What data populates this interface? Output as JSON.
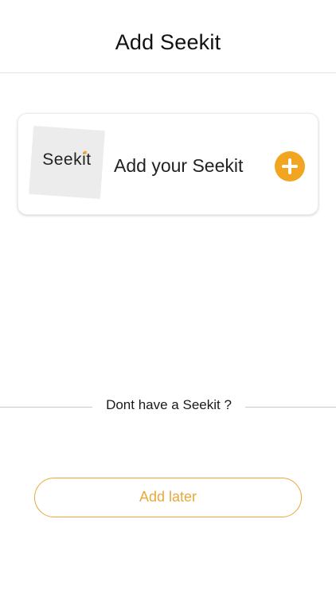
{
  "header": {
    "title": "Add Seekit"
  },
  "add_card": {
    "logo_text": "Seekit",
    "label": "Add your Seekit",
    "plus_icon": "plus-icon"
  },
  "divider": {
    "text": "Dont have a Seekit ?"
  },
  "later_button": {
    "label": "Add later"
  },
  "colors": {
    "accent": "#f2a521",
    "button_text": "#e8a93a"
  }
}
